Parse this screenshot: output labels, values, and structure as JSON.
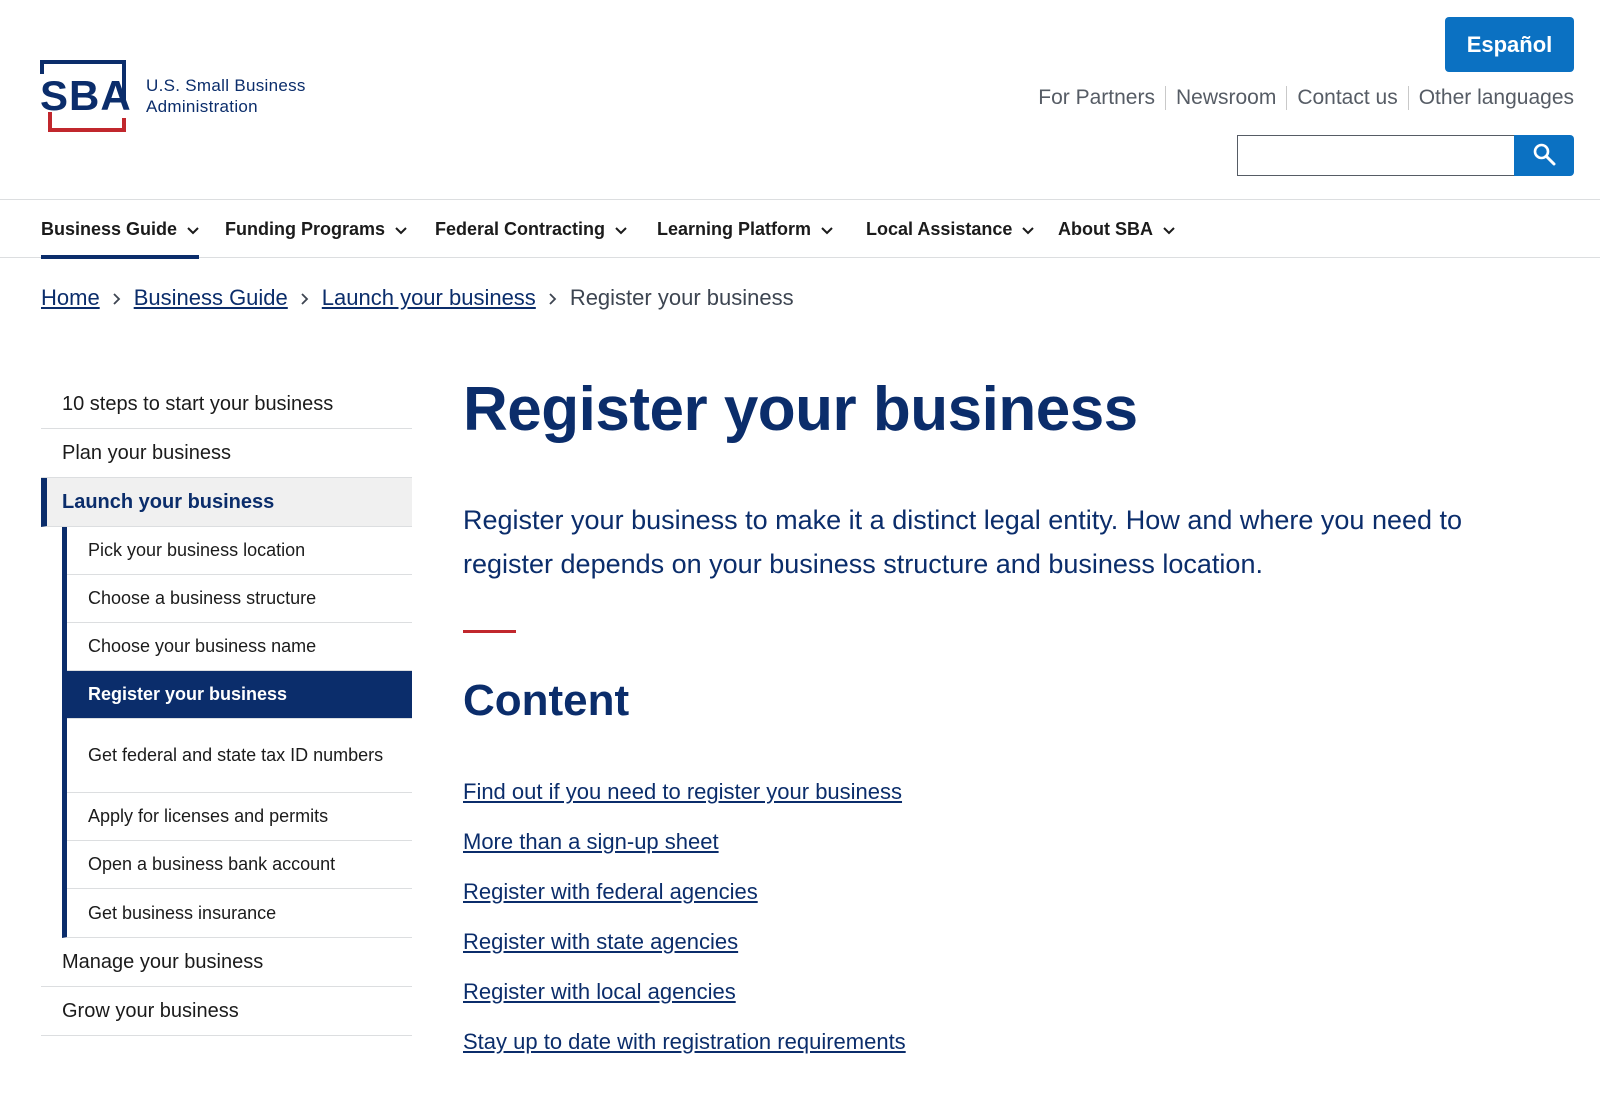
{
  "header": {
    "logo": {
      "mark": "SBA",
      "line1": "U.S. Small Business",
      "line2": "Administration"
    },
    "espanol_label": "Español",
    "util_links": [
      "For Partners",
      "Newsroom",
      "Contact us",
      "Other languages"
    ],
    "search": {
      "value": "",
      "icon": "search-icon"
    }
  },
  "nav": {
    "items": [
      {
        "label": "Business Guide",
        "active": true
      },
      {
        "label": "Funding Programs"
      },
      {
        "label": "Federal Contracting"
      },
      {
        "label": "Learning Platform"
      },
      {
        "label": "Local Assistance"
      },
      {
        "label": "About SBA"
      }
    ]
  },
  "breadcrumb": {
    "links": [
      "Home",
      "Business Guide",
      "Launch your business"
    ],
    "current": "Register your business"
  },
  "sidebar": {
    "items": [
      "10 steps to start your business",
      "Plan your business",
      "Launch your business",
      "Manage your business",
      "Grow your business"
    ],
    "current_index": 2,
    "sub_items": [
      "Pick your business location",
      "Choose a business structure",
      "Choose your business name",
      "Register your business",
      "Get federal and state tax ID numbers",
      "Apply for licenses and permits",
      "Open a business bank account",
      "Get business insurance"
    ],
    "selected_sub_index": 3
  },
  "main": {
    "title": "Register your business",
    "intro": "Register your business to make it a distinct legal entity. How and where you need to register depends on your business structure and business location.",
    "content_heading": "Content",
    "toc": [
      "Find out if you need to register your business",
      "More than a sign-up sheet",
      "Register with federal agencies",
      "Register with state agencies",
      "Register with local agencies",
      "Stay up to date with registration requirements"
    ]
  },
  "colors": {
    "navy": "#0b2d6b",
    "blue": "#0b71c2",
    "red": "#c1272d",
    "gray_text": "#565c65"
  }
}
